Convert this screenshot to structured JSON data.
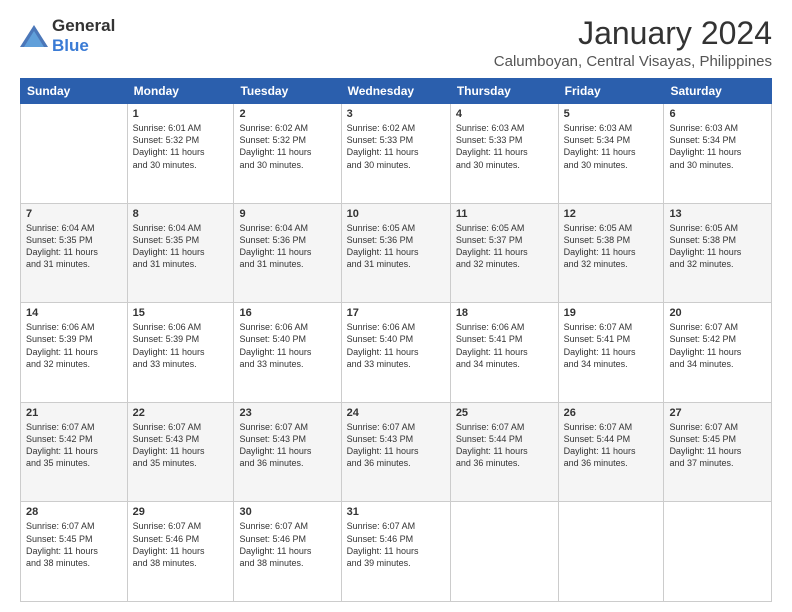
{
  "logo": {
    "text_general": "General",
    "text_blue": "Blue"
  },
  "title": "January 2024",
  "subtitle": "Calumboyan, Central Visayas, Philippines",
  "headers": [
    "Sunday",
    "Monday",
    "Tuesday",
    "Wednesday",
    "Thursday",
    "Friday",
    "Saturday"
  ],
  "weeks": [
    {
      "shaded": false,
      "days": [
        {
          "num": "",
          "detail": ""
        },
        {
          "num": "1",
          "detail": "Sunrise: 6:01 AM\nSunset: 5:32 PM\nDaylight: 11 hours\nand 30 minutes."
        },
        {
          "num": "2",
          "detail": "Sunrise: 6:02 AM\nSunset: 5:32 PM\nDaylight: 11 hours\nand 30 minutes."
        },
        {
          "num": "3",
          "detail": "Sunrise: 6:02 AM\nSunset: 5:33 PM\nDaylight: 11 hours\nand 30 minutes."
        },
        {
          "num": "4",
          "detail": "Sunrise: 6:03 AM\nSunset: 5:33 PM\nDaylight: 11 hours\nand 30 minutes."
        },
        {
          "num": "5",
          "detail": "Sunrise: 6:03 AM\nSunset: 5:34 PM\nDaylight: 11 hours\nand 30 minutes."
        },
        {
          "num": "6",
          "detail": "Sunrise: 6:03 AM\nSunset: 5:34 PM\nDaylight: 11 hours\nand 30 minutes."
        }
      ]
    },
    {
      "shaded": true,
      "days": [
        {
          "num": "7",
          "detail": "Sunrise: 6:04 AM\nSunset: 5:35 PM\nDaylight: 11 hours\nand 31 minutes."
        },
        {
          "num": "8",
          "detail": "Sunrise: 6:04 AM\nSunset: 5:35 PM\nDaylight: 11 hours\nand 31 minutes."
        },
        {
          "num": "9",
          "detail": "Sunrise: 6:04 AM\nSunset: 5:36 PM\nDaylight: 11 hours\nand 31 minutes."
        },
        {
          "num": "10",
          "detail": "Sunrise: 6:05 AM\nSunset: 5:36 PM\nDaylight: 11 hours\nand 31 minutes."
        },
        {
          "num": "11",
          "detail": "Sunrise: 6:05 AM\nSunset: 5:37 PM\nDaylight: 11 hours\nand 32 minutes."
        },
        {
          "num": "12",
          "detail": "Sunrise: 6:05 AM\nSunset: 5:38 PM\nDaylight: 11 hours\nand 32 minutes."
        },
        {
          "num": "13",
          "detail": "Sunrise: 6:05 AM\nSunset: 5:38 PM\nDaylight: 11 hours\nand 32 minutes."
        }
      ]
    },
    {
      "shaded": false,
      "days": [
        {
          "num": "14",
          "detail": "Sunrise: 6:06 AM\nSunset: 5:39 PM\nDaylight: 11 hours\nand 32 minutes."
        },
        {
          "num": "15",
          "detail": "Sunrise: 6:06 AM\nSunset: 5:39 PM\nDaylight: 11 hours\nand 33 minutes."
        },
        {
          "num": "16",
          "detail": "Sunrise: 6:06 AM\nSunset: 5:40 PM\nDaylight: 11 hours\nand 33 minutes."
        },
        {
          "num": "17",
          "detail": "Sunrise: 6:06 AM\nSunset: 5:40 PM\nDaylight: 11 hours\nand 33 minutes."
        },
        {
          "num": "18",
          "detail": "Sunrise: 6:06 AM\nSunset: 5:41 PM\nDaylight: 11 hours\nand 34 minutes."
        },
        {
          "num": "19",
          "detail": "Sunrise: 6:07 AM\nSunset: 5:41 PM\nDaylight: 11 hours\nand 34 minutes."
        },
        {
          "num": "20",
          "detail": "Sunrise: 6:07 AM\nSunset: 5:42 PM\nDaylight: 11 hours\nand 34 minutes."
        }
      ]
    },
    {
      "shaded": true,
      "days": [
        {
          "num": "21",
          "detail": "Sunrise: 6:07 AM\nSunset: 5:42 PM\nDaylight: 11 hours\nand 35 minutes."
        },
        {
          "num": "22",
          "detail": "Sunrise: 6:07 AM\nSunset: 5:43 PM\nDaylight: 11 hours\nand 35 minutes."
        },
        {
          "num": "23",
          "detail": "Sunrise: 6:07 AM\nSunset: 5:43 PM\nDaylight: 11 hours\nand 36 minutes."
        },
        {
          "num": "24",
          "detail": "Sunrise: 6:07 AM\nSunset: 5:43 PM\nDaylight: 11 hours\nand 36 minutes."
        },
        {
          "num": "25",
          "detail": "Sunrise: 6:07 AM\nSunset: 5:44 PM\nDaylight: 11 hours\nand 36 minutes."
        },
        {
          "num": "26",
          "detail": "Sunrise: 6:07 AM\nSunset: 5:44 PM\nDaylight: 11 hours\nand 36 minutes."
        },
        {
          "num": "27",
          "detail": "Sunrise: 6:07 AM\nSunset: 5:45 PM\nDaylight: 11 hours\nand 37 minutes."
        }
      ]
    },
    {
      "shaded": false,
      "days": [
        {
          "num": "28",
          "detail": "Sunrise: 6:07 AM\nSunset: 5:45 PM\nDaylight: 11 hours\nand 38 minutes."
        },
        {
          "num": "29",
          "detail": "Sunrise: 6:07 AM\nSunset: 5:46 PM\nDaylight: 11 hours\nand 38 minutes."
        },
        {
          "num": "30",
          "detail": "Sunrise: 6:07 AM\nSunset: 5:46 PM\nDaylight: 11 hours\nand 38 minutes."
        },
        {
          "num": "31",
          "detail": "Sunrise: 6:07 AM\nSunset: 5:46 PM\nDaylight: 11 hours\nand 39 minutes."
        },
        {
          "num": "",
          "detail": ""
        },
        {
          "num": "",
          "detail": ""
        },
        {
          "num": "",
          "detail": ""
        }
      ]
    }
  ]
}
